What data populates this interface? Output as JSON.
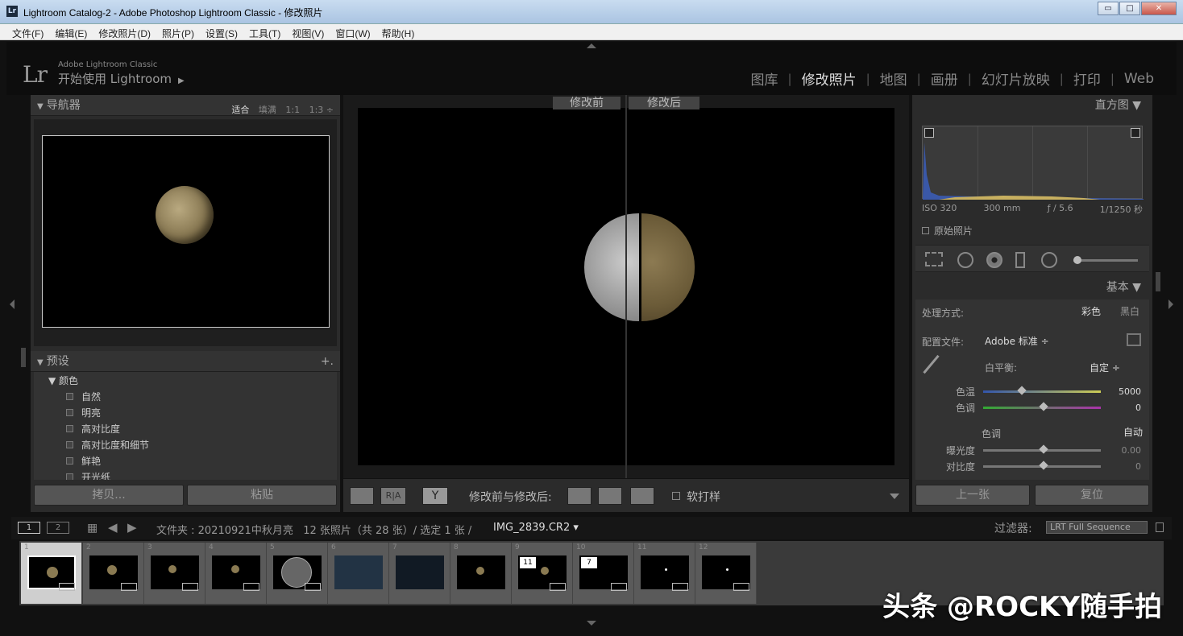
{
  "window": {
    "title": "Lightroom Catalog-2 - Adobe Photoshop Lightroom Classic - 修改照片",
    "icon_label": "Lr",
    "minimize": "▭",
    "maximize": "□",
    "close": "✕"
  },
  "menu": [
    "文件(F)",
    "编辑(E)",
    "修改照片(D)",
    "照片(P)",
    "设置(S)",
    "工具(T)",
    "视图(V)",
    "窗口(W)",
    "帮助(H)"
  ],
  "identity": {
    "logo": "Lr",
    "product": "Adobe Lightroom Classic",
    "plate": "开始使用 Lightroom",
    "play": "▶"
  },
  "modules": [
    "图库",
    "修改照片",
    "地图",
    "画册",
    "幻灯片放映",
    "打印",
    "Web"
  ],
  "active_module": "修改照片",
  "navigator": {
    "title": "导航器",
    "options": [
      "适合",
      "填满",
      "1:1",
      "1:3 ÷"
    ],
    "selected": "适合"
  },
  "presets": {
    "title": "预设",
    "add": "+.",
    "folder": "颜色",
    "items": [
      "自然",
      "明亮",
      "高对比度",
      "高对比度和细节",
      "鲜艳",
      "开光纸"
    ]
  },
  "left_buttons": {
    "copy": "拷贝...",
    "paste": "粘贴"
  },
  "view": {
    "before_label": "修改前",
    "after_label": "修改后"
  },
  "toolbar": {
    "before_after_label": "修改前与修改后:",
    "softproof_label": "软打样",
    "ra_label": "R|A",
    "y_label": "Y"
  },
  "histogram": {
    "title": "直方图 ▼",
    "iso": "ISO 320",
    "focal": "300 mm",
    "aperture": "ƒ / 5.6",
    "shutter": "1/1250 秒",
    "original_photo": "原始照片"
  },
  "basic": {
    "title": "基本 ▼",
    "treatment_label": "处理方式:",
    "treatment_color": "彩色",
    "treatment_bw": "黑白",
    "profile_label": "配置文件:",
    "profile_value": "Adobe 标准 ÷",
    "wb_label": "白平衡:",
    "wb_value": "自定 ÷",
    "temp_label": "色温",
    "temp_value": "5000",
    "tint_label": "色调",
    "tint_value": "0",
    "tone_label": "色调",
    "auto_label": "自动",
    "exposure_label": "曝光度",
    "exposure_value": "0.00",
    "contrast_label": "对比度",
    "contrast_value": "0"
  },
  "right_buttons": {
    "prev": "上一张",
    "reset": "复位"
  },
  "filmbar": {
    "page1": "1",
    "page2": "2",
    "path": "文件夹 : 20210921中秋月亮   12 张照片（共 28 张）/ 选定 1 张 /",
    "filename": "IMG_2839.CR2 ▾",
    "filter_label": "过滤器:",
    "filter_value": "LRT Full Sequence"
  },
  "film_cells": [
    "1",
    "2",
    "3",
    "4",
    "5",
    "6",
    "7",
    "8",
    "9",
    "10",
    "11",
    "12"
  ],
  "stack_badges": {
    "b9": "11",
    "b10": "7"
  },
  "watermark": "头条 @ROCKY随手拍"
}
